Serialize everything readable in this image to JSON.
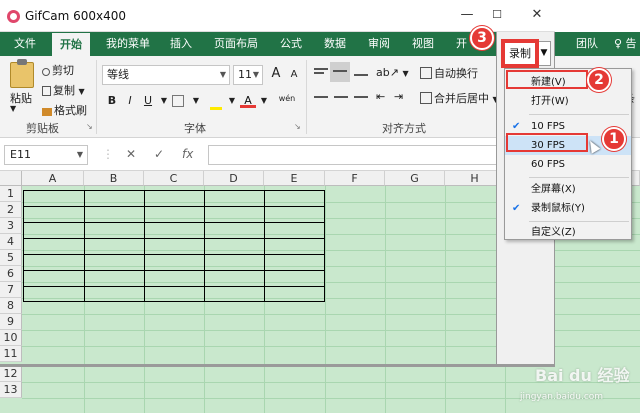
{
  "window": {
    "title": "GifCam 600x400",
    "minimize": "—",
    "maximize": "☐",
    "close": "✕"
  },
  "tabs": [
    {
      "label": "文件"
    },
    {
      "label": "开始"
    },
    {
      "label": "我的菜单"
    },
    {
      "label": "插入"
    },
    {
      "label": "页面布局"
    },
    {
      "label": "公式"
    },
    {
      "label": "数据"
    },
    {
      "label": "审阅"
    },
    {
      "label": "视图"
    },
    {
      "label": "开"
    },
    {
      "label": "团队"
    },
    {
      "label": "♀ 告"
    }
  ],
  "ribbon": {
    "paste": "粘贴",
    "cut": "剪切",
    "copy": "复制",
    "format_painter": "格式刷",
    "clipboard_group": "剪贴板",
    "font_name": "等线",
    "font_size": "11",
    "grow": "A",
    "shrink": "A",
    "bold": "B",
    "italic": "I",
    "underline": "U",
    "wen": "wén",
    "font_group": "字体",
    "wrap_text": "自动换行",
    "merge_center": "合并后居中",
    "align_group": "对齐方式",
    "right_partial": "条"
  },
  "formula_bar": {
    "name_box": "E11",
    "cancel": "✕",
    "enter": "✓",
    "fx": "fx"
  },
  "grid": {
    "columns": [
      "A",
      "B",
      "C",
      "D",
      "E",
      "F",
      "G",
      "H"
    ],
    "rows": [
      "1",
      "2",
      "3",
      "4",
      "5",
      "6",
      "7",
      "8",
      "9",
      "10",
      "11",
      "12",
      "13"
    ]
  },
  "gifcam": {
    "record_label": "录制",
    "dropdown_arrow": "▼"
  },
  "menu": {
    "items": [
      {
        "label": "新建(V)",
        "checked": false
      },
      {
        "label": "打开(W)",
        "checked": false
      },
      {
        "label": "10 FPS",
        "checked": true
      },
      {
        "label": "30 FPS",
        "checked": false,
        "highlighted": true
      },
      {
        "label": "60 FPS",
        "checked": false
      },
      {
        "label": "全屏幕(X)",
        "checked": false
      },
      {
        "label": "录制鼠标(Y)",
        "checked": true
      },
      {
        "label": "自定义(Z)",
        "checked": false
      }
    ],
    "checkmark": "✔"
  },
  "annotations": {
    "badge1": "1",
    "badge2": "2",
    "badge3": "3",
    "accent": "#e53935"
  },
  "watermark": {
    "brand": "Bai du 经验",
    "url": "jingyan.baidu.com"
  }
}
